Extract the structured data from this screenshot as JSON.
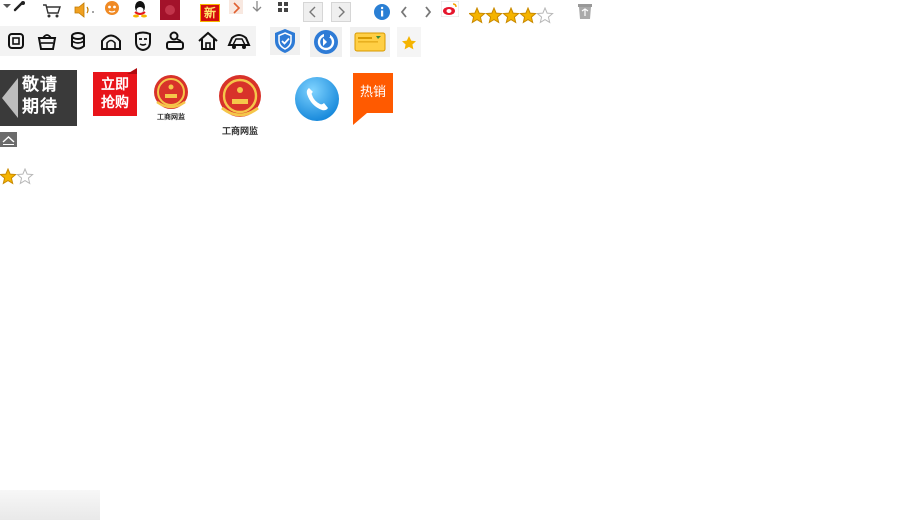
{
  "badges": {
    "coming_soon_line1": "敬请",
    "coming_soon_line2": "期待",
    "buy_now_line1": "立即",
    "buy_now_line2": "抢购",
    "hot_sale": "热销",
    "new_label": "新",
    "seal_text": "工商网监"
  },
  "rating": {
    "stars_filled": 4,
    "stars_total": 5
  },
  "small_rating": {
    "stars_filled": 1,
    "stars_total": 2
  },
  "icons": {
    "top_row": [
      "dropdown-arrow-icon",
      "pen-icon",
      "cart-icon",
      "speaker-icon",
      "pet-icon",
      "qq-icon",
      "red-square-icon",
      "new-badge-icon",
      "chevron-right-icon",
      "download-arrow-icon",
      "grid-icon",
      "prev-button",
      "next-button",
      "info-icon",
      "chevron-left-icon",
      "chevron-right-icon",
      "weibo-icon",
      "star-rating",
      "recycle-bin-icon"
    ],
    "category_strip": [
      "tablet-icon",
      "basket-icon",
      "stack-icon",
      "tunnel-icon",
      "mask-icon",
      "baby-icon",
      "home-icon",
      "car-icon"
    ],
    "service_row": [
      "shield-icon",
      "refresh-icon",
      "email-icon",
      "favorite-star-icon"
    ]
  },
  "colors": {
    "badge_red": "#e8141a",
    "hot_orange": "#ff5a00",
    "badge_dark": "#3a3a3a",
    "star_gold": "#f5b400",
    "shield_blue": "#2e7bd6",
    "phone_blue": "#1e9be8"
  }
}
